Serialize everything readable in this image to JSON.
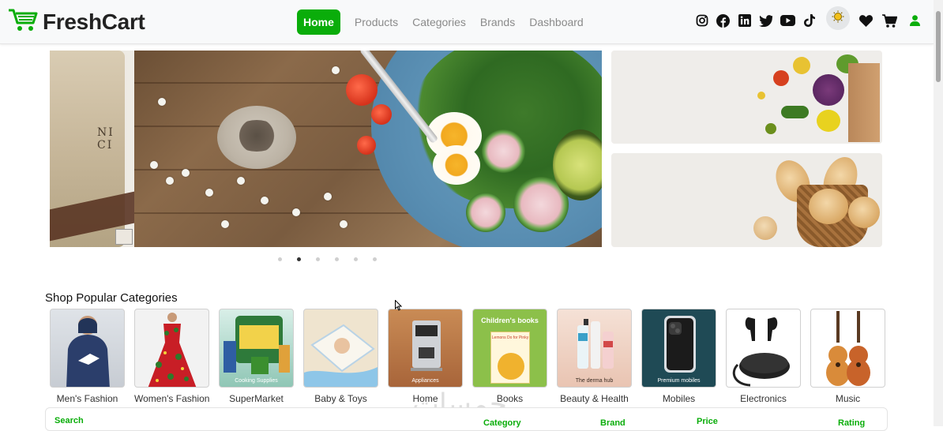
{
  "app": {
    "name": "FreshCart",
    "accent_color": "#0aad0a"
  },
  "nav": {
    "links": [
      {
        "label": "Home",
        "active": true
      },
      {
        "label": "Products",
        "active": false
      },
      {
        "label": "Categories",
        "active": false
      },
      {
        "label": "Brands",
        "active": false
      },
      {
        "label": "Dashboard",
        "active": false
      }
    ],
    "icons": [
      "instagram-icon",
      "facebook-icon",
      "linkedin-icon",
      "twitter-icon",
      "youtube-icon",
      "tiktok-icon",
      "theme-toggle-sun-icon",
      "heart-icon",
      "cart-icon",
      "user-icon"
    ]
  },
  "hero": {
    "slide_count": 6,
    "active_slide_index": 1,
    "main_image": "salad-bowl",
    "side_images": [
      "vegetables-paper-bag",
      "bread-basket"
    ]
  },
  "categories": {
    "title": "Shop Popular Categories",
    "items": [
      {
        "label": "Men's Fashion",
        "thumb": "hoodie",
        "caption": ""
      },
      {
        "label": "Women's Fashion",
        "thumb": "floral-dress",
        "caption": ""
      },
      {
        "label": "SuperMarket",
        "thumb": "grocery",
        "caption": "Cooking Supplies"
      },
      {
        "label": "Baby & Toys",
        "thumb": "baby-diapers",
        "caption": ""
      },
      {
        "label": "Home",
        "thumb": "coffee-machine",
        "caption": "Appliances"
      },
      {
        "label": "Books",
        "thumb": "book",
        "caption": "Children's books",
        "book_title": "Lemons Do for Pinky"
      },
      {
        "label": "Beauty & Health",
        "thumb": "skincare",
        "caption": "The derma hub"
      },
      {
        "label": "Mobiles",
        "thumb": "phone",
        "caption": "Premium mobiles"
      },
      {
        "label": "Electronics",
        "thumb": "earbuds",
        "caption": ""
      },
      {
        "label": "Music",
        "thumb": "guitars",
        "caption": ""
      }
    ],
    "dot_count": 10,
    "active_dot_index": 1
  },
  "filters": {
    "labels": [
      "Search",
      "Category",
      "Brand",
      "Price",
      "Rating"
    ]
  },
  "watermark": "خمسات"
}
